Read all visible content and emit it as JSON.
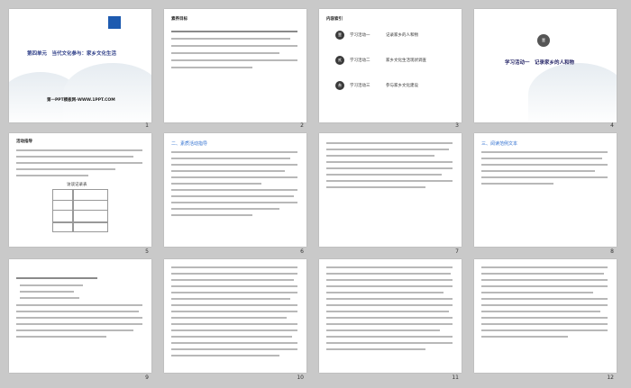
{
  "slides": [
    {
      "num": "1",
      "title": "第四单元　当代文化参与：家乡文化生活",
      "subtitle": "第一PPT模板网-WWW.1PPT.COM"
    },
    {
      "num": "2",
      "heading": "素养目标"
    },
    {
      "num": "3",
      "heading": "内容索引",
      "items": [
        {
          "badge": "壹",
          "activity": "学习活动一",
          "name": "记录家乡的人和物"
        },
        {
          "badge": "贰",
          "activity": "学习活动二",
          "name": "家乡文化生活现状调查"
        },
        {
          "badge": "叁",
          "activity": "学习活动三",
          "name": "参与家乡文化建设"
        }
      ]
    },
    {
      "num": "4",
      "badge": "壹",
      "title": "学习活动一　记录家乡的人和物"
    },
    {
      "num": "5",
      "heading": "活动指导",
      "table_title": "访谈记录表"
    },
    {
      "num": "6",
      "heading": "二、素质活动指导"
    },
    {
      "num": "7"
    },
    {
      "num": "8",
      "heading": "三、阅读范例文本"
    },
    {
      "num": "9"
    },
    {
      "num": "10"
    },
    {
      "num": "11"
    },
    {
      "num": "12"
    }
  ]
}
